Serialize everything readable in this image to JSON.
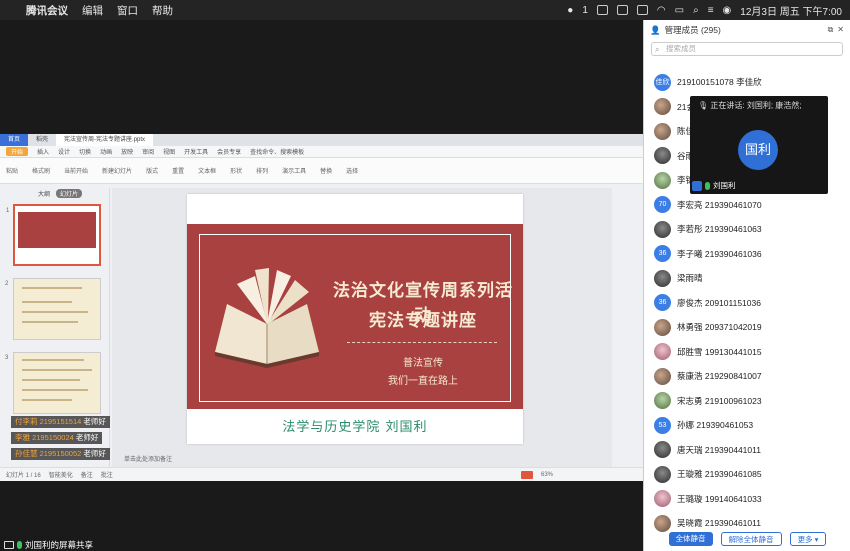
{
  "menubar": {
    "app": "腾讯会议",
    "items": [
      "编辑",
      "窗口",
      "帮助"
    ],
    "wechat_count": "1",
    "datetime": "12月3日 周五 下午7:00"
  },
  "wps": {
    "tabs": [
      "首页",
      "稻壳",
      "宪法宣传周-宪法专题讲座.pptx"
    ],
    "ribbon_tabs": [
      "开始",
      "插入",
      "设计",
      "切换",
      "动画",
      "放映",
      "审阅",
      "视图",
      "开发工具",
      "会员专享",
      "查找命令、搜索模板"
    ],
    "ribbon_items": [
      "粘贴",
      "格式刷",
      "当前开始",
      "新建幻灯片",
      "版式",
      "重置",
      "文本框",
      "形状",
      "排列",
      "演示工具",
      "替换",
      "选择"
    ],
    "outline_label": "大纲",
    "slides_label": "幻灯片",
    "notes_placeholder": "单击此处添加备注",
    "status": [
      "幻灯片 1 / 16",
      "智能美化",
      "备注",
      "批注"
    ],
    "zoom": "63%"
  },
  "slide": {
    "title_line1": "法治文化宣传周系列活动",
    "title_line2": "宪法专题讲座",
    "subtitle_line1": "普法宣传",
    "subtitle_line2": "我们一直在路上",
    "footer": "法学与历史学院  刘国利"
  },
  "chat": [
    {
      "who": "付李莉 2195151514",
      "text": "老师好"
    },
    {
      "who": "李雅 2195150024",
      "text": "老师好"
    },
    {
      "who": "孙佳慧 2195150052",
      "text": "老师好"
    }
  ],
  "share_label": "刘国利的屏幕共享",
  "panel": {
    "title": "管理成员 (295)",
    "search_placeholder": "搜索成员",
    "members": [
      {
        "name": "219100151078 李佳欣",
        "avatar_text": "佳欣",
        "style": "av-blue"
      },
      {
        "name": "21会计二班 邓晓",
        "avatar_text": "",
        "style": "av-photo"
      },
      {
        "name": "陈佳",
        "avatar_text": "",
        "style": "av-photo"
      },
      {
        "name": "谷雨",
        "avatar_text": "",
        "style": "av-dark"
      },
      {
        "name": "李锦",
        "avatar_text": "",
        "style": "av-green"
      },
      {
        "name": "李宏亮 219390461070",
        "avatar_text": "70",
        "style": "av-blue"
      },
      {
        "name": "李若彤 219390461063",
        "avatar_text": "",
        "style": "av-dark"
      },
      {
        "name": "李子曦 219390461036",
        "avatar_text": "36",
        "style": "av-blue"
      },
      {
        "name": "梁雨晴",
        "avatar_text": "",
        "style": "av-dark"
      },
      {
        "name": "廖俊杰 209101151036",
        "avatar_text": "36",
        "style": "av-blue"
      },
      {
        "name": "林勇强 209371042019",
        "avatar_text": "",
        "style": "av-photo"
      },
      {
        "name": "邱胜雪 199130441015",
        "avatar_text": "",
        "style": "av-pink"
      },
      {
        "name": "蔡康浩 219290841007",
        "avatar_text": "",
        "style": "av-photo"
      },
      {
        "name": "宋志勇 219100961023",
        "avatar_text": "",
        "style": "av-green"
      },
      {
        "name": "孙娜 219390461053",
        "avatar_text": "53",
        "style": "av-blue"
      },
      {
        "name": "唐天瑞 219390441011",
        "avatar_text": "",
        "style": "av-dark"
      },
      {
        "name": "王璇雅 219390461085",
        "avatar_text": "",
        "style": "av-dark"
      },
      {
        "name": "王璐璇 199140641033",
        "avatar_text": "",
        "style": "av-pink"
      },
      {
        "name": "吴晓霞 219390461011",
        "avatar_text": "",
        "style": "av-photo"
      }
    ],
    "buttons": {
      "mute_all": "全体静音",
      "unmute_all": "解除全体静音",
      "more": "更多 ▾"
    }
  },
  "speaker": {
    "status": "正在讲话: 刘国利; 康浩然;",
    "initials": "国利",
    "name": "刘国利"
  },
  "colors": {
    "accent": "#2f6fd6",
    "slide_red": "#a8413f",
    "footer_green": "#2a8a6c"
  }
}
